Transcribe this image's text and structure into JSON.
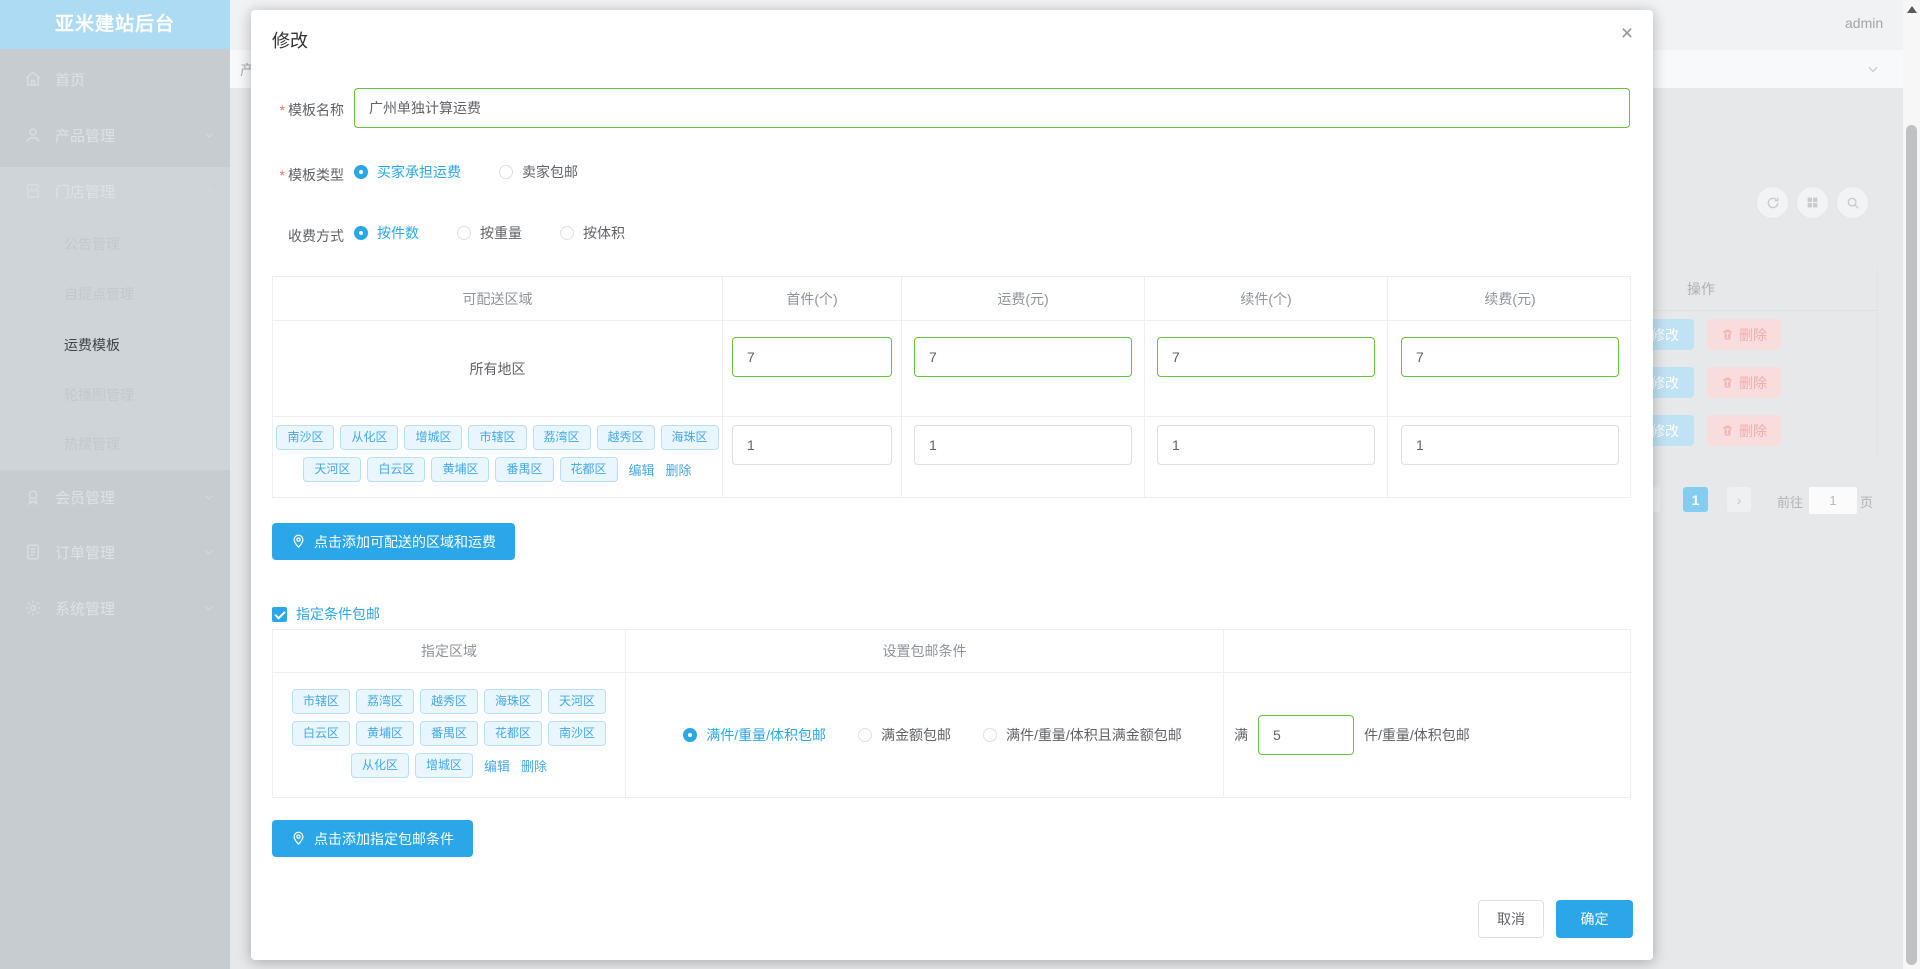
{
  "app": {
    "brand": "亚米建站后台",
    "user": "admin",
    "tab_fragment": "产"
  },
  "sidebar": {
    "items": [
      {
        "label": "首页"
      },
      {
        "label": "产品管理"
      },
      {
        "label": "门店管理"
      },
      {
        "label": "会员管理"
      },
      {
        "label": "订单管理"
      },
      {
        "label": "系统管理"
      }
    ],
    "store_submenu": [
      "公告管理",
      "自提点管理",
      "运费模板",
      "轮播图管理",
      "热搜管理"
    ],
    "active_submenu": "运费模板"
  },
  "background": {
    "op_header": "操作",
    "rows": [
      {
        "edit": "修改",
        "del": "删除"
      },
      {
        "edit": "修改",
        "del": "删除"
      },
      {
        "edit": "修改",
        "del": "删除"
      }
    ],
    "pagination": {
      "prev": "‹",
      "current": "1",
      "next": "›",
      "goto_label": "前往",
      "goto_value": "1",
      "unit": "页"
    }
  },
  "modal": {
    "title": "修改",
    "close": "×",
    "required_mark": "*",
    "name": {
      "label": "模板名称",
      "value": "广州单独计算运费"
    },
    "type": {
      "label": "模板类型",
      "options": [
        "买家承担运费",
        "卖家包邮"
      ],
      "selected": "买家承担运费"
    },
    "charge": {
      "label": "收费方式",
      "options": [
        "按件数",
        "按重量",
        "按体积"
      ],
      "selected": "按件数"
    },
    "table1": {
      "headers": [
        "可配送区域",
        "首件(个)",
        "运费(元)",
        "续件(个)",
        "续费(元)"
      ],
      "row1": {
        "region": "所有地区",
        "values": [
          "7",
          "7",
          "7",
          "7"
        ]
      },
      "row2": {
        "tags_line1": [
          "南沙区",
          "从化区",
          "增城区",
          "市辖区",
          "荔湾区",
          "越秀区",
          "海珠区"
        ],
        "tags_line2": [
          "天河区",
          "白云区",
          "黄埔区",
          "番禺区",
          "花都区"
        ],
        "edit": "编辑",
        "del": "删除",
        "values": [
          "1",
          "1",
          "1",
          "1"
        ]
      }
    },
    "add_region_button": "点击添加可配送的区域和运费",
    "condition_checkbox": {
      "label": "指定条件包邮",
      "checked": true
    },
    "table2": {
      "headers": [
        "指定区域",
        "设置包邮条件",
        ""
      ],
      "tags_line1": [
        "市辖区",
        "荔湾区",
        "越秀区",
        "海珠区",
        "天河区"
      ],
      "tags_line2": [
        "白云区",
        "黄埔区",
        "番禺区",
        "花都区",
        "南沙区"
      ],
      "tags_line3": [
        "从化区",
        "增城区"
      ],
      "edit": "编辑",
      "del": "删除",
      "options": [
        "满件/重量/体积包邮",
        "满金额包邮",
        "满件/重量/体积且满金额包邮"
      ],
      "selected": "满件/重量/体积包邮",
      "threshold": {
        "prefix": "满",
        "value": "5",
        "suffix": "件/重量/体积包邮"
      }
    },
    "add_condition_button": "点击添加指定包邮条件",
    "footer": {
      "cancel": "取消",
      "confirm": "确定"
    }
  },
  "colors": {
    "primary": "#2aa7e8",
    "valid_border": "#67c23a",
    "tag_blue": "#45a8e6",
    "asterisk": "#f56c6c",
    "sidebar_header": "#addbf3"
  }
}
